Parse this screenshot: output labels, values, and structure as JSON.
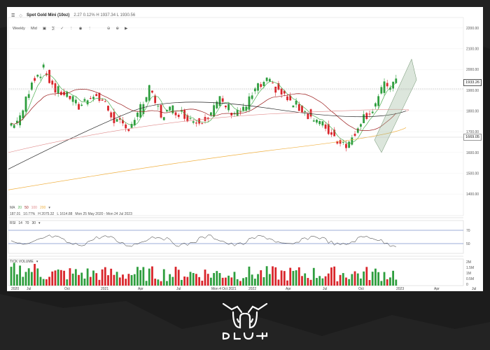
{
  "header": {
    "symbol": "Spot Gold Mini (10oz)",
    "stats": "2.27  0.12%  H 1937.34  L 1930.56"
  },
  "toolbar": {
    "timeframe": "Weekly",
    "price_type": "Mid"
  },
  "legends": {
    "ma": [
      "MA",
      "20",
      "50",
      "100",
      "200",
      "▾"
    ],
    "stats_line": [
      "187.01",
      "10.77%",
      "H 2075.32",
      "L 1614.88",
      "Mon 25 May 2020 - Mon 24 Jul 2023"
    ],
    "rsi": [
      "RSI",
      "14",
      "70",
      "30",
      "▾"
    ],
    "volume": [
      "TICK VOLUME",
      "▾"
    ]
  },
  "price_axis": [
    "2200.00",
    "2100.00",
    "2000.00",
    "1900.00",
    "1800.00",
    "1700.00",
    "1600.00",
    "1500.00",
    "1400.00"
  ],
  "price_tags": {
    "last": "1933.26",
    "level": "1669.05"
  },
  "rsi_axis": [
    "70",
    "50"
  ],
  "volume_axis": [
    "2M",
    "1.5M",
    "1M",
    "0.5M",
    "0"
  ],
  "time_axis": [
    "2020",
    "Jul",
    "Oct",
    "2021",
    "Apr",
    "Jul",
    "Mon 4 Oct 2021",
    "2022",
    "Apr",
    "Jul",
    "Oct",
    "2023",
    "Apr",
    "Jul"
  ],
  "colors": {
    "up": "#2e9e3e",
    "down": "#d9252b",
    "ma20": "#4caf50",
    "ma50": "#9c1c1c",
    "ma100": "#e08a8a",
    "ma200": "#f0b040",
    "black_ma": "#222222",
    "channel": "#9bb89b"
  },
  "chart_data": {
    "type": "candlestick",
    "title": "Spot Gold Mini (10oz)",
    "timeframe": "Weekly",
    "y_range": [
      1350,
      2220
    ],
    "x_range": [
      "2020-05",
      "2023-07"
    ],
    "price_series": {
      "name": "Spot Gold Mini (10oz)",
      "points": [
        [
          "2020-05",
          1730
        ],
        [
          "2020-06",
          1760
        ],
        [
          "2020-07",
          1950
        ],
        [
          "2020-08",
          2000
        ],
        [
          "2020-09",
          1900
        ],
        [
          "2020-10",
          1880
        ],
        [
          "2020-11",
          1820
        ],
        [
          "2020-12",
          1880
        ],
        [
          "2021-01",
          1850
        ],
        [
          "2021-02",
          1760
        ],
        [
          "2021-03",
          1710
        ],
        [
          "2021-04",
          1780
        ],
        [
          "2021-05",
          1900
        ],
        [
          "2021-06",
          1780
        ],
        [
          "2021-07",
          1810
        ],
        [
          "2021-08",
          1780
        ],
        [
          "2021-09",
          1750
        ],
        [
          "2021-10",
          1780
        ],
        [
          "2021-11",
          1850
        ],
        [
          "2021-12",
          1800
        ],
        [
          "2022-01",
          1800
        ],
        [
          "2022-02",
          1900
        ],
        [
          "2022-03",
          1940
        ],
        [
          "2022-04",
          1900
        ],
        [
          "2022-05",
          1840
        ],
        [
          "2022-06",
          1810
        ],
        [
          "2022-07",
          1760
        ],
        [
          "2022-08",
          1720
        ],
        [
          "2022-09",
          1660
        ],
        [
          "2022-10",
          1640
        ],
        [
          "2022-11",
          1760
        ],
        [
          "2022-12",
          1810
        ],
        [
          "2023-01",
          1920
        ],
        [
          "2023-02",
          1933
        ]
      ]
    },
    "rsi_levels": [
      70,
      50
    ],
    "volume_max": 2000000
  }
}
